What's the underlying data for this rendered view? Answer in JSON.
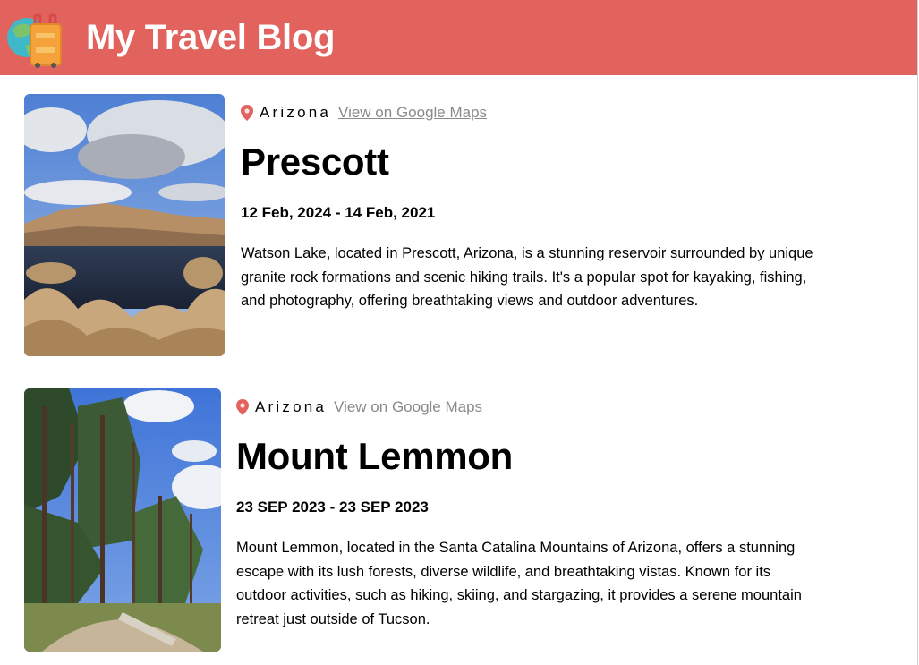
{
  "header": {
    "title": "My Travel Blog",
    "logo_icon": "globe-suitcase-icon",
    "background": "#e2625d"
  },
  "entries": [
    {
      "location": "Arizona",
      "maps_link": "View on Google Maps",
      "place": "Prescott",
      "dates": "12 Feb, 2024 - 14 Feb, 2021",
      "description": "Watson Lake, located in Prescott, Arizona, is a stunning reservoir surrounded by unique granite rock formations and scenic hiking trails. It's a popular spot for kayaking, fishing, and photography, offering breathtaking views and outdoor adventures."
    },
    {
      "location": "Arizona",
      "maps_link": "View on Google Maps",
      "place": "Mount Lemmon",
      "dates": "23 SEP 2023 - 23 SEP 2023",
      "description": "Mount Lemmon, located in the Santa Catalina Mountains of Arizona, offers a stunning escape with its lush forests, diverse wildlife, and breathtaking vistas. Known for its outdoor activities, such as hiking, skiing, and stargazing, it provides a serene mountain retreat just outside of Tucson."
    }
  ],
  "colors": {
    "accent": "#e2625d",
    "link": "#8a8a8a",
    "pin": "#e2625d"
  }
}
